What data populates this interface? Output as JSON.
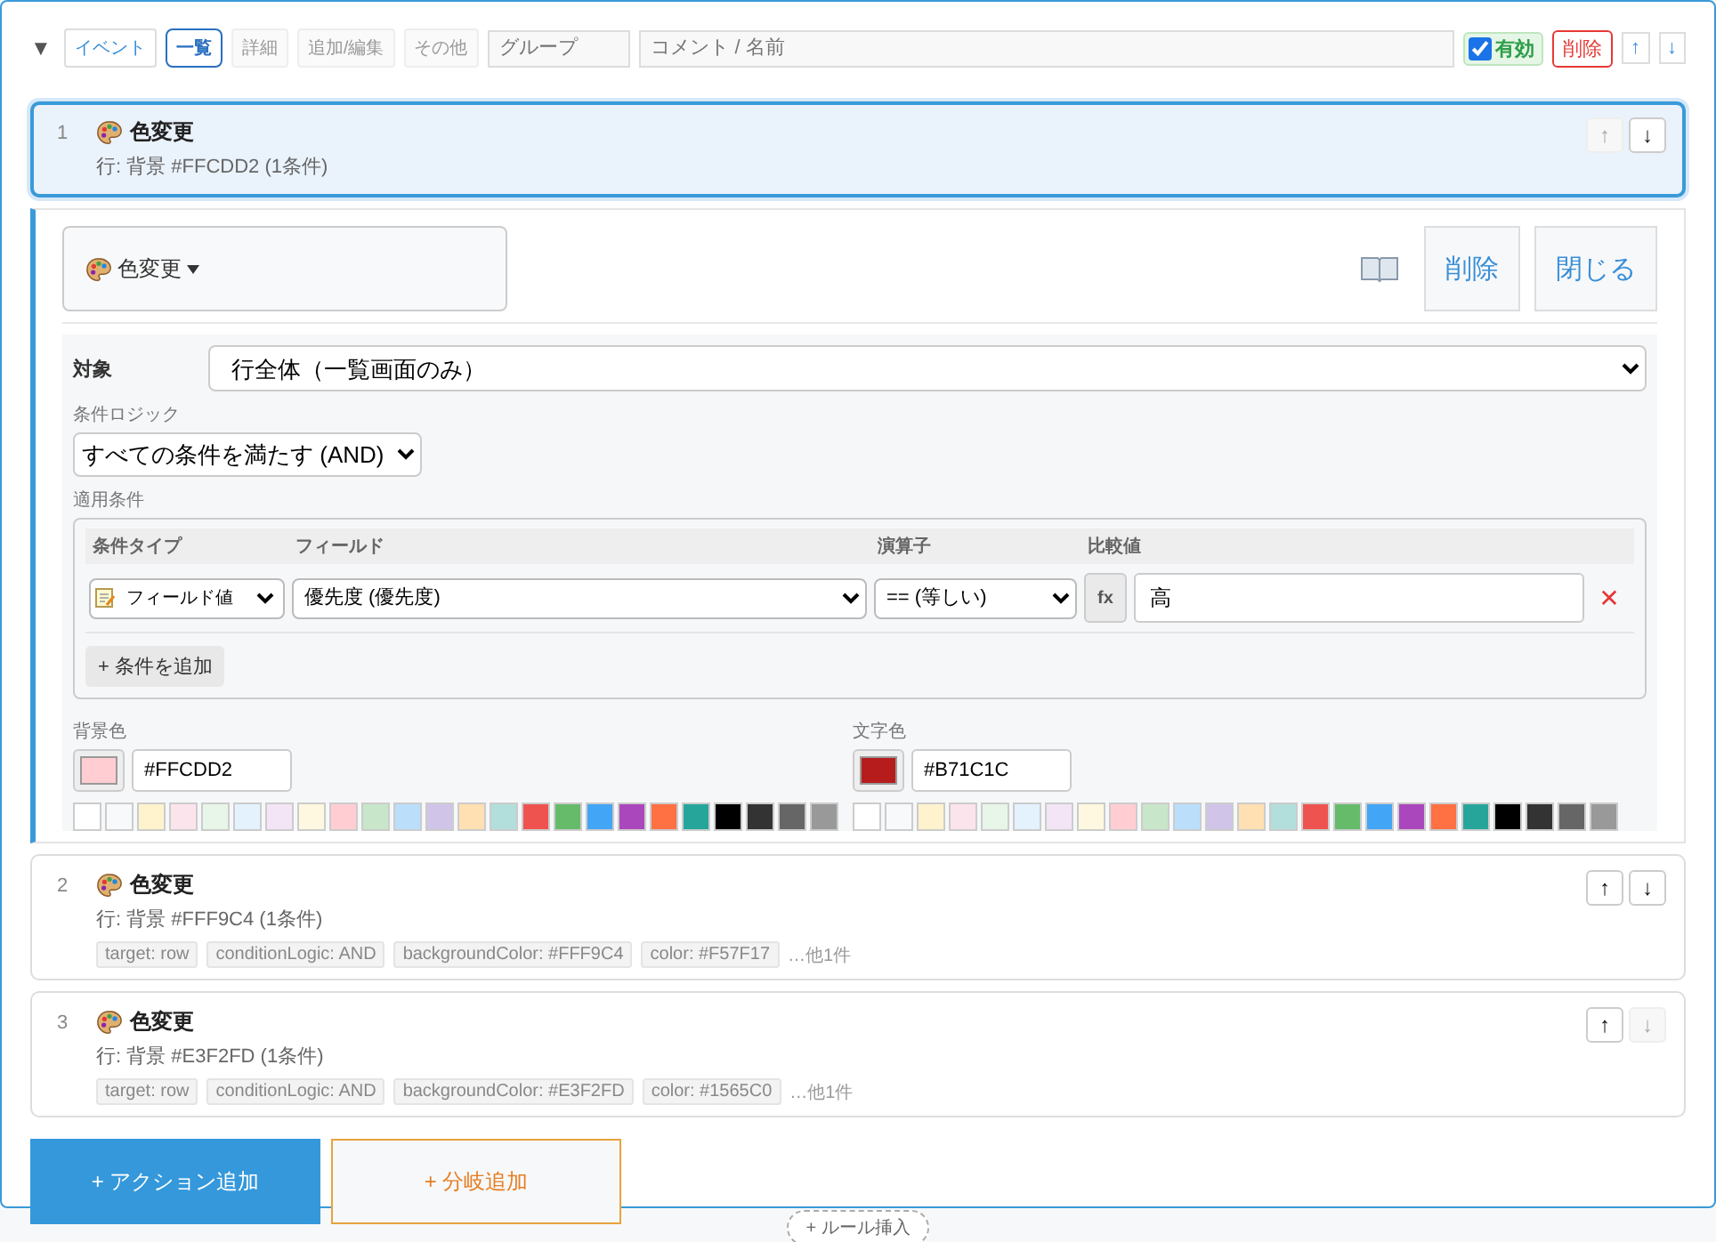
{
  "header": {
    "collapse_icon": "▼",
    "tabs": [
      {
        "label": "イベント",
        "selected": false,
        "disabled": false
      },
      {
        "label": "一覧",
        "selected": true,
        "disabled": false
      },
      {
        "label": "詳細",
        "selected": false,
        "disabled": true
      },
      {
        "label": "追加/編集",
        "selected": false,
        "disabled": true
      },
      {
        "label": "その他",
        "selected": false,
        "disabled": true
      }
    ],
    "group_field": {
      "placeholder": "グループ"
    },
    "comment_field": {
      "placeholder": "コメント / 名前"
    },
    "enabled": {
      "label": "有効",
      "checked": true
    },
    "delete_label": "削除",
    "move_up": "↑",
    "move_down": "↓"
  },
  "actions": [
    {
      "number": "1",
      "title": "色変更",
      "summary": "行: 背景 #FFCDD2 (1条件)",
      "selected": true,
      "up": {
        "label": "↑",
        "disabled": true
      },
      "down": {
        "label": "↓",
        "disabled": false
      }
    },
    {
      "number": "2",
      "title": "色変更",
      "summary": "行: 背景 #FFF9C4 (1条件)",
      "selected": false,
      "up": {
        "label": "↑",
        "disabled": false
      },
      "down": {
        "label": "↓",
        "disabled": false
      },
      "tags": [
        "target: row",
        "conditionLogic: AND",
        "backgroundColor: #FFF9C4",
        "color: #F57F17"
      ],
      "more": "…他1件"
    },
    {
      "number": "3",
      "title": "色変更",
      "summary": "行: 背景 #E3F2FD (1条件)",
      "selected": false,
      "up": {
        "label": "↑",
        "disabled": false
      },
      "down": {
        "label": "↓",
        "disabled": true
      },
      "tags": [
        "target: row",
        "conditionLogic: AND",
        "backgroundColor: #E3F2FD",
        "color: #1565C0"
      ],
      "more": "…他1件"
    }
  ],
  "editor": {
    "type_button": "色変更",
    "delete": "削除",
    "close": "閉じる",
    "target": {
      "label": "対象",
      "value": "行全体（一覧画面のみ）"
    },
    "logic": {
      "label": "条件ロジック",
      "value": "すべての条件を満たす (AND)"
    },
    "conditions": {
      "label": "適用条件",
      "columns": [
        "条件タイプ",
        "フィールド",
        "演算子",
        "比較値"
      ],
      "rows": [
        {
          "type": "フィールド値",
          "field": "優先度 (優先度)",
          "operator": "== (等しい)",
          "fx": "fx",
          "value": "高",
          "remove": "✕"
        }
      ],
      "add": "+ 条件を追加"
    },
    "background": {
      "label": "背景色",
      "color": "#ffcdd2",
      "value": "#FFCDD2",
      "palette": [
        {
          "color": "#ffffff"
        },
        {
          "color": "#f8f9fa"
        },
        {
          "color": "#fff3cd"
        },
        {
          "color": "#fce4ec"
        },
        {
          "color": "#e8f5e9"
        },
        {
          "color": "#e3f2fd"
        },
        {
          "color": "#f3e5f5"
        },
        {
          "color": "#fff8e1"
        },
        {
          "color": "#ffcdd2"
        },
        {
          "color": "#c8e6c9"
        },
        {
          "color": "#bbdefb"
        },
        {
          "color": "#d1c4e9"
        },
        {
          "color": "#ffe0b2"
        },
        {
          "color": "#b2dfdb"
        },
        {
          "color": "#ef5350"
        },
        {
          "color": "#66bb6a"
        },
        {
          "color": "#42a5f5"
        },
        {
          "color": "#ab47bc"
        },
        {
          "color": "#ff7043"
        },
        {
          "color": "#26a69a"
        },
        {
          "color": "#000000"
        },
        {
          "color": "#333333"
        },
        {
          "color": "#666666"
        },
        {
          "color": "#999999"
        }
      ]
    },
    "text_color": {
      "label": "文字色",
      "color": "#b71c1c",
      "value": "#B71C1C",
      "palette": [
        {
          "color": "#ffffff"
        },
        {
          "color": "#f8f9fa"
        },
        {
          "color": "#fff3cd"
        },
        {
          "color": "#fce4ec"
        },
        {
          "color": "#e8f5e9"
        },
        {
          "color": "#e3f2fd"
        },
        {
          "color": "#f3e5f5"
        },
        {
          "color": "#fff8e1"
        },
        {
          "color": "#ffcdd2"
        },
        {
          "color": "#c8e6c9"
        },
        {
          "color": "#bbdefb"
        },
        {
          "color": "#d1c4e9"
        },
        {
          "color": "#ffe0b2"
        },
        {
          "color": "#b2dfdb"
        },
        {
          "color": "#ef5350"
        },
        {
          "color": "#66bb6a"
        },
        {
          "color": "#42a5f5"
        },
        {
          "color": "#ab47bc"
        },
        {
          "color": "#ff7043"
        },
        {
          "color": "#26a69a"
        },
        {
          "color": "#000000"
        },
        {
          "color": "#333333"
        },
        {
          "color": "#666666"
        },
        {
          "color": "#999999"
        }
      ]
    }
  },
  "footer": {
    "add_action": "+ アクション追加",
    "add_branch": "+ 分岐追加"
  },
  "insert_rule": "+ ルール挿入"
}
